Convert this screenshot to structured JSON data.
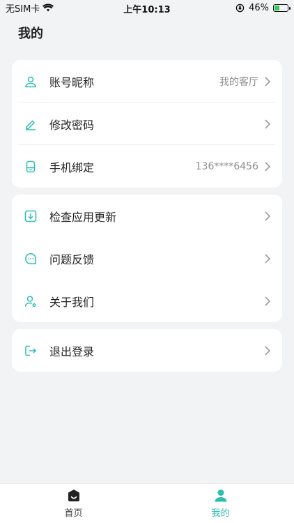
{
  "status_bar": {
    "carrier": "无SIM卡",
    "time": "上午10:13",
    "battery": "46%",
    "battery_level": 0.46
  },
  "page": {
    "title": "我的"
  },
  "groups": [
    {
      "items": [
        {
          "label": "账号昵称",
          "value": "我的客厅",
          "icon": "user-icon"
        },
        {
          "label": "修改密码",
          "value": "",
          "icon": "edit-icon"
        },
        {
          "label": "手机绑定",
          "value": "136****6456",
          "icon": "phone-icon"
        }
      ]
    },
    {
      "items": [
        {
          "label": "检查应用更新",
          "icon": "download-icon"
        },
        {
          "label": "问题反馈",
          "icon": "chat-icon"
        },
        {
          "label": "关于我们",
          "icon": "about-user-icon"
        }
      ]
    },
    {
      "items": [
        {
          "label": "退出登录",
          "icon": "logout-icon"
        }
      ]
    }
  ],
  "tabbar": {
    "home": "首页",
    "mine": "我的"
  },
  "colors": {
    "accent": "#2bbfae",
    "background": "#f2f3f5"
  }
}
